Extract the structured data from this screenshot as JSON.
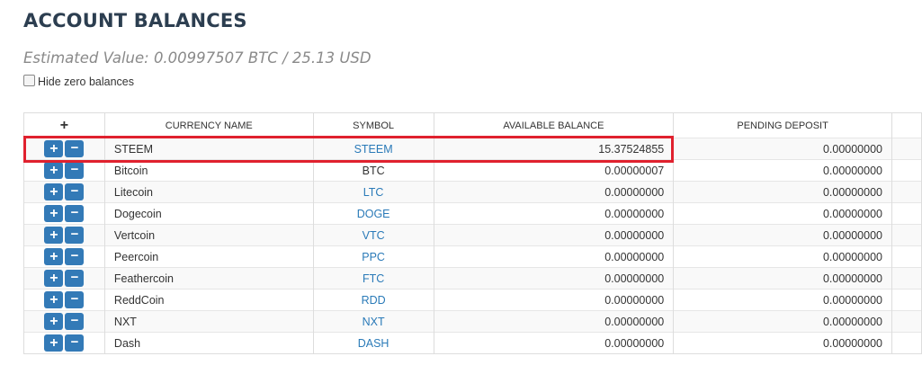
{
  "header": {
    "title": "ACCOUNT BALANCES",
    "estimated_value": "Estimated Value: 0.00997507 BTC / 25.13 USD",
    "hide_zero_label": "Hide zero balances"
  },
  "table": {
    "columns": {
      "actions": "+",
      "currency_name": "CURRENCY NAME",
      "symbol": "SYMBOL",
      "available_balance": "AVAILABLE BALANCE",
      "pending_deposit": "PENDING DEPOSIT"
    },
    "rows": [
      {
        "name": "STEEM",
        "symbol": "STEEM",
        "available": "15.37524855",
        "pending": "0.00000000",
        "symbol_link": true
      },
      {
        "name": "Bitcoin",
        "symbol": "BTC",
        "available": "0.00000007",
        "pending": "0.00000000",
        "symbol_link": false
      },
      {
        "name": "Litecoin",
        "symbol": "LTC",
        "available": "0.00000000",
        "pending": "0.00000000",
        "symbol_link": true
      },
      {
        "name": "Dogecoin",
        "symbol": "DOGE",
        "available": "0.00000000",
        "pending": "0.00000000",
        "symbol_link": true
      },
      {
        "name": "Vertcoin",
        "symbol": "VTC",
        "available": "0.00000000",
        "pending": "0.00000000",
        "symbol_link": true
      },
      {
        "name": "Peercoin",
        "symbol": "PPC",
        "available": "0.00000000",
        "pending": "0.00000000",
        "symbol_link": true
      },
      {
        "name": "Feathercoin",
        "symbol": "FTC",
        "available": "0.00000000",
        "pending": "0.00000000",
        "symbol_link": true
      },
      {
        "name": "ReddCoin",
        "symbol": "RDD",
        "available": "0.00000000",
        "pending": "0.00000000",
        "symbol_link": true
      },
      {
        "name": "NXT",
        "symbol": "NXT",
        "available": "0.00000000",
        "pending": "0.00000000",
        "symbol_link": true
      },
      {
        "name": "Dash",
        "symbol": "DASH",
        "available": "0.00000000",
        "pending": "0.00000000",
        "symbol_link": true
      }
    ],
    "deposit_button_icon": "plus-icon",
    "withdraw_button_icon": "minus-icon",
    "deposit_glyph": "+",
    "withdraw_glyph": "−"
  },
  "colors": {
    "button": "#337ab7",
    "symbol_link": "#2a7ab8",
    "highlight": "#e0212e",
    "title": "#2c3e50"
  }
}
